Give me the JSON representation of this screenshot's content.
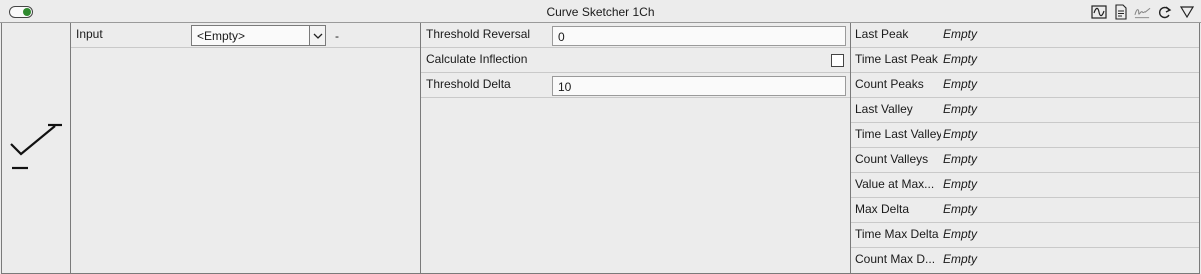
{
  "window": {
    "title": "Curve Sketcher 1Ch",
    "toolbar_icons": [
      "waveform-icon",
      "document-icon",
      "signature-icon",
      "redo-icon",
      "dropdown-triangle-icon"
    ]
  },
  "input_panel": {
    "input_label": "Input",
    "input_value": "<Empty>",
    "unit": "-"
  },
  "params": {
    "threshold_reversal_label": "Threshold Reversal",
    "threshold_reversal_value": "0",
    "calculate_inflection_label": "Calculate Inflection",
    "calculate_inflection_checked": false,
    "threshold_delta_label": "Threshold Delta",
    "threshold_delta_value": "10"
  },
  "results": [
    {
      "label": "Last Peak",
      "value": "Empty"
    },
    {
      "label": "Time Last Peak",
      "value": "Empty"
    },
    {
      "label": "Count Peaks",
      "value": "Empty"
    },
    {
      "label": "Last Valley",
      "value": "Empty"
    },
    {
      "label": "Time Last Valley",
      "value": "Empty"
    },
    {
      "label": "Count Valleys",
      "value": "Empty"
    },
    {
      "label": "Value at Max...",
      "value": "Empty"
    },
    {
      "label": "Max Delta",
      "value": "Empty"
    },
    {
      "label": "Time Max Delta",
      "value": "Empty"
    },
    {
      "label": "Count Max D...",
      "value": "Empty"
    }
  ],
  "colors": {
    "toggle_on": "#2f8a2f",
    "background": "#ececec",
    "border": "#7a7a7a"
  }
}
